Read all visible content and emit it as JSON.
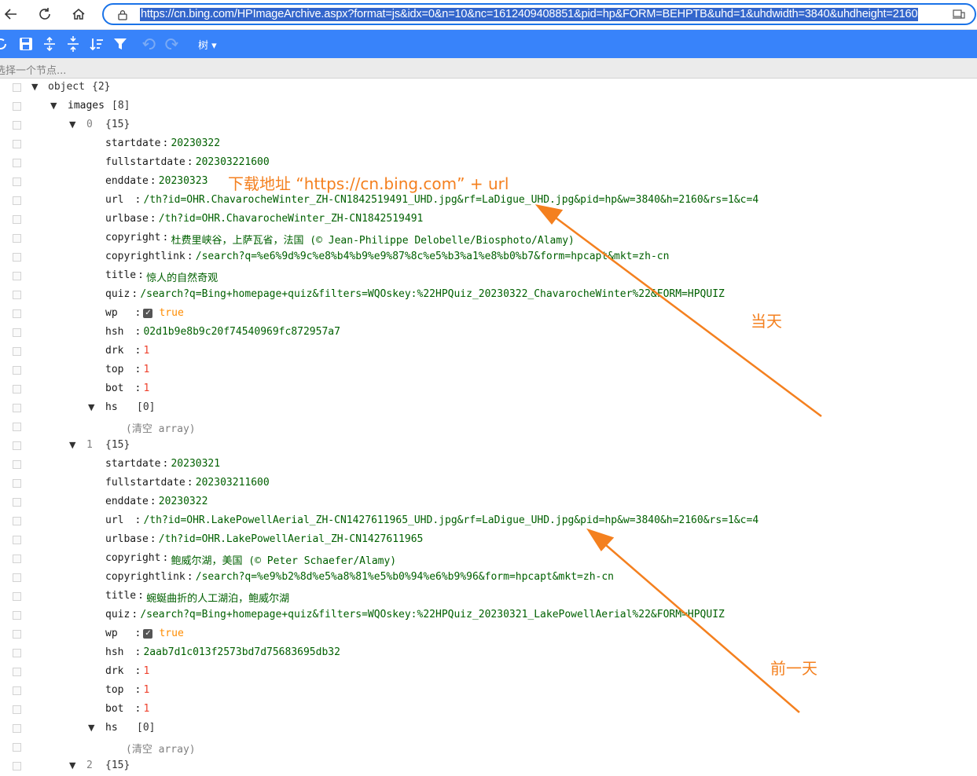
{
  "browser": {
    "back_icon": "arrow-left-icon",
    "refresh_icon": "refresh-icon",
    "home_icon": "home-icon",
    "lock_icon": "lock-icon",
    "url": "https://cn.bing.com/HPImageArchive.aspx?format=js&idx=0&n=10&nc=1612409408851&pid=hp&FORM=BEHPTB&uhd=1&uhdwidth=3840&uhdheight=2160"
  },
  "toolbar": {
    "accent": "#3883fa",
    "mode_label": "树 ▾"
  },
  "path_bar": {
    "text": "选择一个节点..."
  },
  "tree": {
    "root_key": "object",
    "root_count": "{2}",
    "images_key": "images",
    "images_count": "[8]",
    "items": [
      {
        "index": "0",
        "count": "{15}",
        "fields": [
          {
            "key": "startdate",
            "value": "20230322",
            "type": "str"
          },
          {
            "key": "fullstartdate",
            "value": "202303221600",
            "type": "str"
          },
          {
            "key": "enddate",
            "value": "20230323",
            "type": "str"
          },
          {
            "key": "url",
            "value": "/th?id=OHR.ChavarocheWinter_ZH-CN1842519491_UHD.jpg&rf=LaDigue_UHD.jpg&pid=hp&w=3840&h=2160&rs=1&c=4",
            "type": "str"
          },
          {
            "key": "urlbase",
            "value": "/th?id=OHR.ChavarocheWinter_ZH-CN1842519491",
            "type": "str"
          },
          {
            "key": "copyright",
            "value": "杜费里峡谷，上萨瓦省，法国 (© Jean-Philippe Delobelle/Biosphoto/Alamy)",
            "type": "str"
          },
          {
            "key": "copyrightlink",
            "value": "/search?q=%e6%9d%9c%e8%b4%b9%e9%87%8c%e5%b3%a1%e8%b0%b7&form=hpcapt&mkt=zh-cn",
            "type": "str"
          },
          {
            "key": "title",
            "value": "惊人的自然奇观",
            "type": "str"
          },
          {
            "key": "quiz",
            "value": "/search?q=Bing+homepage+quiz&filters=WQOskey:%22HPQuiz_20230322_ChavarocheWinter%22&FORM=HPQUIZ",
            "type": "str"
          },
          {
            "key": "wp",
            "value": "true",
            "type": "bool"
          },
          {
            "key": "hsh",
            "value": "02d1b9e8b9c20f74540969fc872957a7",
            "type": "str"
          },
          {
            "key": "drk",
            "value": "1",
            "type": "num"
          },
          {
            "key": "top",
            "value": "1",
            "type": "num"
          },
          {
            "key": "bot",
            "value": "1",
            "type": "num"
          }
        ],
        "hs_key": "hs",
        "hs_count": "[0]",
        "hs_empty": "(清空 array)"
      },
      {
        "index": "1",
        "count": "{15}",
        "fields": [
          {
            "key": "startdate",
            "value": "20230321",
            "type": "str"
          },
          {
            "key": "fullstartdate",
            "value": "202303211600",
            "type": "str"
          },
          {
            "key": "enddate",
            "value": "20230322",
            "type": "str"
          },
          {
            "key": "url",
            "value": "/th?id=OHR.LakePowellAerial_ZH-CN1427611965_UHD.jpg&rf=LaDigue_UHD.jpg&pid=hp&w=3840&h=2160&rs=1&c=4",
            "type": "str"
          },
          {
            "key": "urlbase",
            "value": "/th?id=OHR.LakePowellAerial_ZH-CN1427611965",
            "type": "str"
          },
          {
            "key": "copyright",
            "value": "鲍威尔湖，美国 (© Peter Schaefer/Alamy)",
            "type": "str"
          },
          {
            "key": "copyrightlink",
            "value": "/search?q=%e9%b2%8d%e5%a8%81%e5%b0%94%e6%b9%96&form=hpcapt&mkt=zh-cn",
            "type": "str"
          },
          {
            "key": "title",
            "value": "蜿蜒曲折的人工湖泊，鲍威尔湖",
            "type": "str"
          },
          {
            "key": "quiz",
            "value": "/search?q=Bing+homepage+quiz&filters=WQOskey:%22HPQuiz_20230321_LakePowellAerial%22&FORM=HPQUIZ",
            "type": "str"
          },
          {
            "key": "wp",
            "value": "true",
            "type": "bool"
          },
          {
            "key": "hsh",
            "value": "2aab7d1c013f2573bd7d75683695db32",
            "type": "str"
          },
          {
            "key": "drk",
            "value": "1",
            "type": "num"
          },
          {
            "key": "top",
            "value": "1",
            "type": "num"
          },
          {
            "key": "bot",
            "value": "1",
            "type": "num"
          }
        ],
        "hs_key": "hs",
        "hs_count": "[0]",
        "hs_empty": "(清空 array)"
      }
    ],
    "next_index": "2",
    "next_count": "{15}"
  },
  "annotations": {
    "download_note": "下载地址 “https://cn.bing.com” + url",
    "today_label": "当天",
    "previous_day_label": "前一天",
    "color": "#f4801f"
  }
}
